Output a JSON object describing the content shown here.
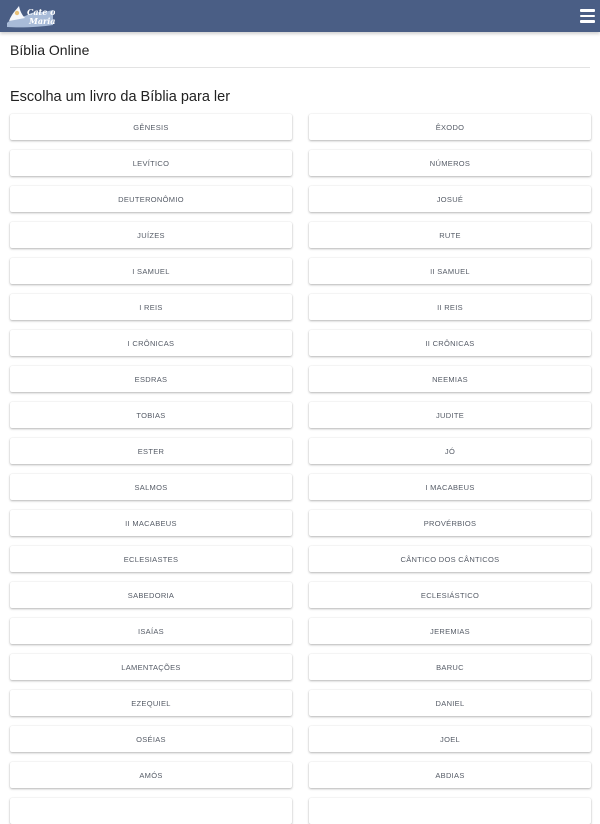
{
  "header": {
    "logo_text_line1": "Cate o",
    "logo_text_line2": "Maria",
    "menu_icon": "hamburger-menu-icon",
    "background_color": "#4a5e85"
  },
  "page": {
    "title": "Bíblia Online",
    "subtitle": "Escolha um livro da Bíblia para ler"
  },
  "books": [
    {
      "label": "GÊNESIS"
    },
    {
      "label": "ÊXODO"
    },
    {
      "label": "LEVÍTICO"
    },
    {
      "label": "NÚMEROS"
    },
    {
      "label": "DEUTERONÔMIO"
    },
    {
      "label": "JOSUÉ"
    },
    {
      "label": "JUÍZES"
    },
    {
      "label": "RUTE"
    },
    {
      "label": "I SAMUEL"
    },
    {
      "label": "II SAMUEL"
    },
    {
      "label": "I REIS"
    },
    {
      "label": "II REIS"
    },
    {
      "label": "I CRÔNICAS"
    },
    {
      "label": "II CRÔNICAS"
    },
    {
      "label": "ESDRAS"
    },
    {
      "label": "NEEMIAS"
    },
    {
      "label": "TOBIAS"
    },
    {
      "label": "JUDITE"
    },
    {
      "label": "ESTER"
    },
    {
      "label": "JÓ"
    },
    {
      "label": "SALMOS"
    },
    {
      "label": "I MACABEUS"
    },
    {
      "label": "II MACABEUS"
    },
    {
      "label": "PROVÉRBIOS"
    },
    {
      "label": "ECLESIASTES"
    },
    {
      "label": "CÂNTICO DOS CÂNTICOS"
    },
    {
      "label": "SABEDORIA"
    },
    {
      "label": "ECLESIÁSTICO"
    },
    {
      "label": "ISAÍAS"
    },
    {
      "label": "JEREMIAS"
    },
    {
      "label": "LAMENTAÇÕES"
    },
    {
      "label": "BARUC"
    },
    {
      "label": "EZEQUIEL"
    },
    {
      "label": "DANIEL"
    },
    {
      "label": "OSÉIAS"
    },
    {
      "label": "JOEL"
    },
    {
      "label": "AMÓS"
    },
    {
      "label": "ABDIAS"
    },
    {
      "label": ""
    },
    {
      "label": ""
    }
  ]
}
